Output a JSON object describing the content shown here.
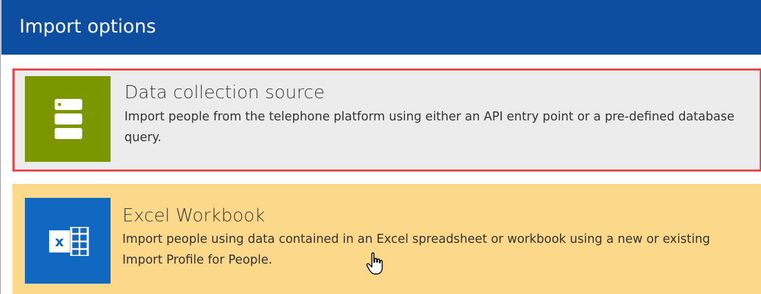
{
  "header": {
    "title": "Import options"
  },
  "options": [
    {
      "title": "Data collection source",
      "description": "Import people from the telephone platform using either an API entry point or a pre-defined database query.",
      "icon": "database-icon",
      "tile_color": "#7c9600",
      "selected": true
    },
    {
      "title": "Excel Workbook",
      "description": "Import people using data contained in an Excel spreadsheet or workbook using a new or existing Import Profile for People.",
      "icon": "excel-icon",
      "tile_color": "#1068c0",
      "hovered": true
    }
  ],
  "colors": {
    "header_bg": "#0e4ea0",
    "selected_border": "#e8484c",
    "hover_bg": "#fcd88a",
    "card_bg": "#ececec"
  }
}
